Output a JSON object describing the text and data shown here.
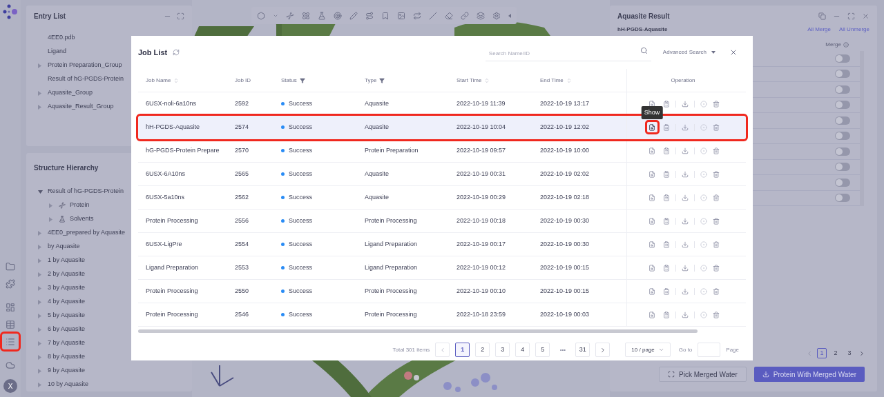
{
  "rail": {
    "items": [
      {
        "kind": "folder",
        "framed": false
      },
      {
        "kind": "puzzle",
        "framed": false
      },
      {
        "kind": "layout",
        "framed": false
      },
      {
        "kind": "table",
        "framed": false
      },
      {
        "kind": "list",
        "framed": true
      },
      {
        "kind": "cloud",
        "framed": false
      }
    ],
    "avatar": "X"
  },
  "entry_list": {
    "title": "Entry List",
    "items": [
      {
        "label": "4EE0.pdb",
        "expandable": false
      },
      {
        "label": "Ligand",
        "expandable": false
      },
      {
        "label": "Protein Preparation_Group",
        "expandable": true
      },
      {
        "label": "Result of hG-PGDS-Protein",
        "expandable": false
      },
      {
        "label": "Aquasite_Group",
        "expandable": true
      },
      {
        "label": "Aquasite_Result_Group",
        "expandable": true
      }
    ]
  },
  "structure_hierarchy": {
    "title": "Structure Hierarchy",
    "items": [
      {
        "label": "Result of hG-PGDS-Protein",
        "expanded": true,
        "children": [
          {
            "label": "Protein",
            "kind": "protein",
            "expanded": false
          },
          {
            "label": "Solvents",
            "kind": "solvent",
            "expanded": false
          }
        ]
      },
      {
        "label": "4EE0_prepared by Aquasite",
        "expanded": false
      },
      {
        "label": "by Aquasite",
        "expanded": false
      },
      {
        "label": "1 by Aquasite",
        "expanded": false
      },
      {
        "label": "2 by Aquasite",
        "expanded": false
      },
      {
        "label": "3 by Aquasite",
        "expanded": false
      },
      {
        "label": "4 by Aquasite",
        "expanded": false
      },
      {
        "label": "5 by Aquasite",
        "expanded": false
      },
      {
        "label": "6 by Aquasite",
        "expanded": false
      },
      {
        "label": "7 by Aquasite",
        "expanded": false
      },
      {
        "label": "8 by Aquasite",
        "expanded": false
      },
      {
        "label": "9 by Aquasite",
        "expanded": false
      },
      {
        "label": "10 by Aquasite",
        "expanded": false
      }
    ]
  },
  "aquasite_result": {
    "title": "Aquasite Result",
    "subtitle": "hH-PGDS-Aquasite",
    "links": [
      "All Merge",
      "All Unmerge"
    ],
    "merge_header": "Merge",
    "rows": [
      {
        "on": false
      },
      {
        "on": false
      },
      {
        "on": false
      },
      {
        "on": false
      },
      {
        "on": false
      },
      {
        "on": false
      },
      {
        "on": false
      },
      {
        "on": false
      },
      {
        "on": false
      },
      {
        "on": false
      }
    ],
    "pages": [
      {
        "label": "1",
        "selected": true
      },
      {
        "label": "2",
        "selected": false
      },
      {
        "label": "3",
        "selected": false
      }
    ],
    "buttons": [
      {
        "label": "Pick Merged Water",
        "kind": "secondary"
      },
      {
        "label": "Protein With Merged Water",
        "kind": "primary"
      }
    ]
  },
  "job_list": {
    "title": "Job List",
    "search": {
      "placeholder": "Search Name/ID"
    },
    "advanced_search": "Advanced Search",
    "columns": [
      {
        "label": "Job Name",
        "kind": "sortable"
      },
      {
        "label": "Job ID",
        "kind": "plain"
      },
      {
        "label": "Status",
        "kind": "filterable"
      },
      {
        "label": "Type",
        "kind": "filterable"
      },
      {
        "label": "Start Time",
        "kind": "sortable"
      },
      {
        "label": "End Time",
        "kind": "sortable"
      },
      {
        "label": "Operation",
        "kind": "plain"
      }
    ],
    "rows": [
      {
        "name": "6USX-noli-6a10ns",
        "id": "2592",
        "status": "Success",
        "type": "Aquasite",
        "start": "2022-10-19 11:39",
        "end": "2022-10-19 13:17",
        "selected": false,
        "framed": false
      },
      {
        "name": "hH-PGDS-Aquasite",
        "id": "2574",
        "status": "Success",
        "type": "Aquasite",
        "start": "2022-10-19 10:04",
        "end": "2022-10-19 12:02",
        "selected": true,
        "framed": true,
        "tooltip": "Show"
      },
      {
        "name": "hG-PGDS-Protein Prepare",
        "id": "2570",
        "status": "Success",
        "type": "Protein Preparation",
        "start": "2022-10-19 09:57",
        "end": "2022-10-19 10:00",
        "selected": false,
        "framed": false
      },
      {
        "name": "6USX-6A10ns",
        "id": "2565",
        "status": "Success",
        "type": "Aquasite",
        "start": "2022-10-19 00:31",
        "end": "2022-10-19 02:02",
        "selected": false,
        "framed": false
      },
      {
        "name": "6USX-5a10ns",
        "id": "2562",
        "status": "Success",
        "type": "Aquasite",
        "start": "2022-10-19 00:29",
        "end": "2022-10-19 02:18",
        "selected": false,
        "framed": false
      },
      {
        "name": "Protein Processing",
        "id": "2556",
        "status": "Success",
        "type": "Protein Processing",
        "start": "2022-10-19 00:18",
        "end": "2022-10-19 00:30",
        "selected": false,
        "framed": false
      },
      {
        "name": "6USX-LigPre",
        "id": "2554",
        "status": "Success",
        "type": "Ligand Preparation",
        "start": "2022-10-19 00:17",
        "end": "2022-10-19 00:30",
        "selected": false,
        "framed": false
      },
      {
        "name": "Ligand Preparation",
        "id": "2553",
        "status": "Success",
        "type": "Ligand Preparation",
        "start": "2022-10-19 00:12",
        "end": "2022-10-19 00:15",
        "selected": false,
        "framed": false
      },
      {
        "name": "Protein Processing",
        "id": "2550",
        "status": "Success",
        "type": "Protein Processing",
        "start": "2022-10-19 00:10",
        "end": "2022-10-19 00:15",
        "selected": false,
        "framed": false
      },
      {
        "name": "Protein Processing",
        "id": "2546",
        "status": "Success",
        "type": "Protein Processing",
        "start": "2022-10-18 23:59",
        "end": "2022-10-19 00:03",
        "selected": false,
        "framed": false
      }
    ],
    "total": "Total 301 items",
    "pages": [
      {
        "label": "1",
        "kind": "page",
        "selected": true
      },
      {
        "label": "2",
        "kind": "page",
        "selected": false
      },
      {
        "label": "3",
        "kind": "page",
        "selected": false
      },
      {
        "label": "4",
        "kind": "page",
        "selected": false
      },
      {
        "label": "5",
        "kind": "page",
        "selected": false
      },
      {
        "label": "•••",
        "kind": "more",
        "selected": false
      },
      {
        "label": "31",
        "kind": "page",
        "selected": false
      }
    ],
    "page_size": "10 / page",
    "goto_label": "Go to",
    "page_label": "Page"
  }
}
